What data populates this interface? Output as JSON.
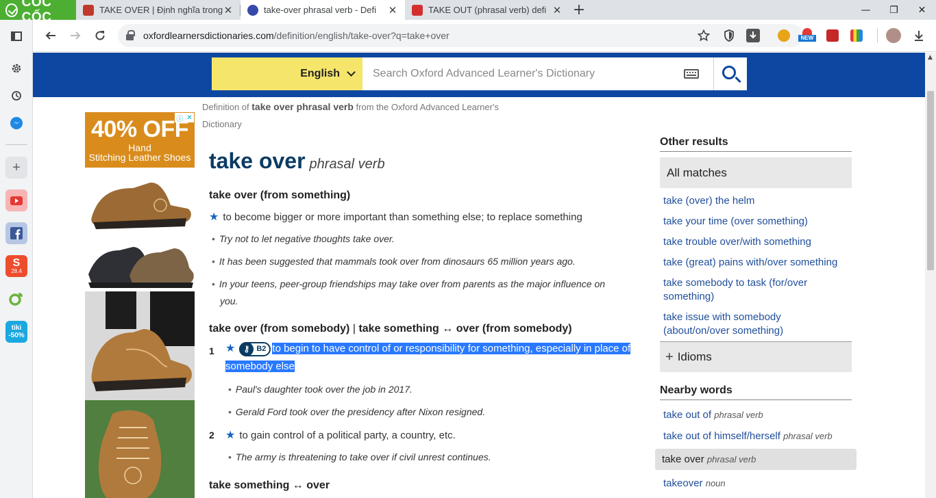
{
  "browser": {
    "brand": "CỐC CỐC",
    "tabs": [
      {
        "title": "TAKE OVER | Định nghĩa trong",
        "favicon_color": "#c0392b"
      },
      {
        "title": "take-over phrasal verb - Defi",
        "favicon_color": "#3949ab"
      },
      {
        "title": "TAKE OUT (phrasal verb) defi",
        "favicon_color": "#d32f2f"
      }
    ],
    "new_tab_label": "+",
    "url_domain": "oxfordlearnersdictionaries.com",
    "url_path": "/definition/english/take-over?q=take+over",
    "ext_new_badge": "NEW"
  },
  "sidebar": {
    "tiki_label": "tiki",
    "tiki_discount": "-50%",
    "shopee_badge": "28.4"
  },
  "oxford": {
    "language": "English",
    "search_placeholder": "Search Oxford Advanced Learner's Dictionary",
    "breadcrumb_prefix": "Definition of ",
    "breadcrumb_term": "take over phrasal verb",
    "breadcrumb_suffix": " from the Oxford Advanced Learner's",
    "breadcrumb_line2": "Dictionary"
  },
  "ad": {
    "headline": "40% OFF",
    "line1": "Hand",
    "line2": "Stitching Leather Shoes"
  },
  "entry": {
    "headword": "take over",
    "pos": "phrasal verb",
    "sense1_head": "take over (from something)",
    "sense1_def": "to become bigger or more important than something else; to replace something",
    "sense1_ex1": "Try not to let negative thoughts take over.",
    "sense1_ex2": "It has been suggested that mammals took over from dinosaurs 65 million years ago.",
    "sense1_ex3a": "In your teens, peer-group friendships may take over from parents as the major influence on",
    "sense1_ex3b": "you.",
    "sense2_head_a": "take over (from somebody)",
    "sense2_head_sep": " | ",
    "sense2_head_b": "take something ↔ over (from somebody)",
    "def1_num": "1",
    "def1_level": "B2",
    "def1_a": "to begin to have control of or responsibility for something, especially in place of",
    "def1_b": "somebody else",
    "def1_ex1": "Paul's daughter took over the job in 2017.",
    "def1_ex2": "Gerald Ford took over the presidency after Nixon resigned.",
    "def2_num": "2",
    "def2": "to gain control of a political party, a country, etc.",
    "def2_ex1": "The army is threatening to take over if civil unrest continues.",
    "sense3_head": "take something ↔ over"
  },
  "other_results": {
    "heading": "Other results",
    "all_matches": "All matches",
    "links": [
      "take (over) the helm",
      "take your time (over something)",
      "take trouble over/with something",
      "take (great) pains with/over something",
      "take somebody to task (for/over",
      "something)",
      "take issue with somebody",
      "(about/on/over something)"
    ],
    "idioms": "Idioms"
  },
  "nearby": {
    "heading": "Nearby words",
    "items": [
      {
        "word": "take out of",
        "pos": "phrasal verb"
      },
      {
        "word": "take out of himself/herself",
        "pos": "phrasal verb"
      },
      {
        "word": "take over",
        "pos": "phrasal verb"
      },
      {
        "word": "takeover",
        "pos": "noun"
      }
    ]
  }
}
